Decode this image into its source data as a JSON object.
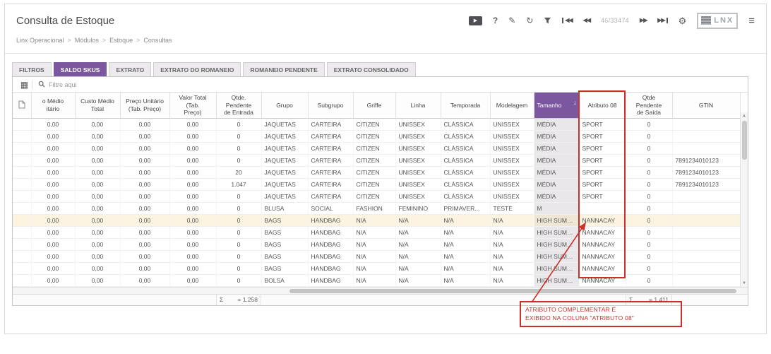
{
  "header": {
    "title": "Consulta de Estoque",
    "counter": "46/33474",
    "logo_text": "LNX"
  },
  "breadcrumb": {
    "separator": ">",
    "items": [
      "Linx Operacional",
      "Módulos",
      "Estoque",
      "Consultas"
    ]
  },
  "tabs": [
    {
      "label": "FILTROS",
      "active": false
    },
    {
      "label": "SALDO SKUS",
      "active": true
    },
    {
      "label": "EXTRATO",
      "active": false
    },
    {
      "label": "EXTRATO DO ROMANEIO",
      "active": false
    },
    {
      "label": "ROMANEIO PENDENTE",
      "active": false
    },
    {
      "label": "EXTRATO CONSOLIDADO",
      "active": false
    }
  ],
  "grid_toolbar": {
    "search_placeholder": "Filtre aqui"
  },
  "table": {
    "columns": [
      {
        "key": "icon",
        "line1": "",
        "line2": ""
      },
      {
        "key": "custo-medio-unitario",
        "line1": "o Médio",
        "line2": "itário"
      },
      {
        "key": "custo-medio-total",
        "line1": "Custo Médio",
        "line2": "Total"
      },
      {
        "key": "preco-unitario",
        "line1": "Preço Unitário",
        "line2": "(Tab. Preço)"
      },
      {
        "key": "valor-total",
        "line1": "Valor Total (Tab.",
        "line2": "Preço)"
      },
      {
        "key": "qtde-pendente-entrada",
        "line1": "Qtde. Pendente",
        "line2": "de Entrada"
      },
      {
        "key": "grupo",
        "line1": "Grupo",
        "line2": ""
      },
      {
        "key": "subgrupo",
        "line1": "Subgrupo",
        "line2": ""
      },
      {
        "key": "griffe",
        "line1": "Griffe",
        "line2": ""
      },
      {
        "key": "linha",
        "line1": "Linha",
        "line2": ""
      },
      {
        "key": "temporada",
        "line1": "Temporada",
        "line2": ""
      },
      {
        "key": "modelagem",
        "line1": "Modelagem",
        "line2": ""
      },
      {
        "key": "tamanho",
        "line1": "Tamanho",
        "line2": "",
        "sorted": "desc"
      },
      {
        "key": "atributo-08",
        "line1": "Atributo 08",
        "line2": ""
      },
      {
        "key": "qtde-pendente-saida",
        "line1": "Qtde Pendente",
        "line2": "de Saída"
      },
      {
        "key": "gtin",
        "line1": "GTIN",
        "line2": ""
      }
    ],
    "rows": [
      {
        "selected": false,
        "cells": [
          "",
          "0,00",
          "0,00",
          "0,00",
          "0,00",
          "0",
          "JAQUETAS",
          "CARTEIRA",
          "CITIZEN",
          "UNISSEX",
          "CLÁSSICA",
          "UNISSEX",
          "MÉDIA",
          "SPORT",
          "0",
          ""
        ]
      },
      {
        "selected": false,
        "cells": [
          "",
          "0,00",
          "0,00",
          "0,00",
          "0,00",
          "0",
          "JAQUETAS",
          "CARTEIRA",
          "CITIZEN",
          "UNISSEX",
          "CLÁSSICA",
          "UNISSEX",
          "MÉDIA",
          "SPORT",
          "0",
          ""
        ]
      },
      {
        "selected": false,
        "cells": [
          "",
          "0,00",
          "0,00",
          "0,00",
          "0,00",
          "0",
          "JAQUETAS",
          "CARTEIRA",
          "CITIZEN",
          "UNISSEX",
          "CLÁSSICA",
          "UNISSEX",
          "MÉDIA",
          "SPORT",
          "0",
          ""
        ]
      },
      {
        "selected": false,
        "cells": [
          "",
          "0,00",
          "0,00",
          "0,00",
          "0,00",
          "0",
          "JAQUETAS",
          "CARTEIRA",
          "CITIZEN",
          "UNISSEX",
          "CLÁSSICA",
          "UNISSEX",
          "MÉDIA",
          "SPORT",
          "0",
          "7891234010123"
        ]
      },
      {
        "selected": false,
        "cells": [
          "",
          "0,00",
          "0,00",
          "0,00",
          "0,00",
          "20",
          "JAQUETAS",
          "CARTEIRA",
          "CITIZEN",
          "UNISSEX",
          "CLÁSSICA",
          "UNISSEX",
          "MÉDIA",
          "SPORT",
          "0",
          "7891234010123"
        ]
      },
      {
        "selected": false,
        "cells": [
          "",
          "0,00",
          "0,00",
          "0,00",
          "0,00",
          "1.047",
          "JAQUETAS",
          "CARTEIRA",
          "CITIZEN",
          "UNISSEX",
          "CLÁSSICA",
          "UNISSEX",
          "MÉDIA",
          "SPORT",
          "0",
          "7891234010123"
        ]
      },
      {
        "selected": false,
        "cells": [
          "",
          "0,00",
          "0,00",
          "0,00",
          "0,00",
          "0",
          "JAQUETAS",
          "CARTEIRA",
          "CITIZEN",
          "UNISSEX",
          "CLÁSSICA",
          "UNISSEX",
          "MÉDIA",
          "SPORT",
          "0",
          ""
        ]
      },
      {
        "selected": false,
        "cells": [
          "",
          "0,00",
          "0,00",
          "0,00",
          "0,00",
          "0",
          "BLUSA",
          "SOCIAL",
          "FASHION",
          "FEMININO",
          "PRIMAVER...",
          "TESTE",
          "M",
          "",
          "0",
          ""
        ]
      },
      {
        "selected": true,
        "cells": [
          "",
          "0,00",
          "0,00",
          "0,00",
          "0,00",
          "0",
          "BAGS",
          "HANDBAG",
          "N/A",
          "N/A",
          "N/A",
          "N/A",
          "HIGH SUMMER ...",
          "NANNACAY",
          "0",
          ""
        ]
      },
      {
        "selected": false,
        "cells": [
          "",
          "0,00",
          "0,00",
          "0,00",
          "0,00",
          "0",
          "BAGS",
          "HANDBAG",
          "N/A",
          "N/A",
          "N/A",
          "N/A",
          "HIGH SUMMER ...",
          "NANNACAY",
          "0",
          ""
        ]
      },
      {
        "selected": false,
        "cells": [
          "",
          "0,00",
          "0,00",
          "0,00",
          "0,00",
          "0",
          "BAGS",
          "HANDBAG",
          "N/A",
          "N/A",
          "N/A",
          "N/A",
          "HIGH SUMMER ...",
          "NANNACAY",
          "0",
          ""
        ]
      },
      {
        "selected": false,
        "cells": [
          "",
          "0,00",
          "0,00",
          "0,00",
          "0,00",
          "0",
          "BAGS",
          "HANDBAG",
          "N/A",
          "N/A",
          "N/A",
          "N/A",
          "HIGH SUMMER ...",
          "NANNACAY",
          "0",
          ""
        ]
      },
      {
        "selected": false,
        "cells": [
          "",
          "0,00",
          "0,00",
          "0,00",
          "0,00",
          "0",
          "BAGS",
          "HANDBAG",
          "N/A",
          "N/A",
          "N/A",
          "N/A",
          "HIGH SUMMER ...",
          "NANNACAY",
          "0",
          ""
        ]
      },
      {
        "selected": false,
        "cells": [
          "",
          "0,00",
          "0,00",
          "0,00",
          "0,00",
          "0",
          "BOLSA",
          "HANDBAG",
          "N/A",
          "N/A",
          "N/A",
          "N/A",
          "HIGH SUMMER ...",
          "NANNACAY",
          "0",
          ""
        ]
      }
    ],
    "summary": {
      "sigma": "Σ",
      "entrada_total": "= 1.258",
      "saida_total": "= 1.411"
    }
  },
  "annotation": {
    "line1": "ATRIBUTO COMPLEMENTAR É",
    "line2": "EXIBIDO NA COLUNA \"ATRIBUTO 08\"",
    "color": "#c9302c"
  },
  "colors": {
    "accent_purple": "#7a579f",
    "selected_row": "#fcf3e1",
    "annotation_red": "#c9302c"
  }
}
